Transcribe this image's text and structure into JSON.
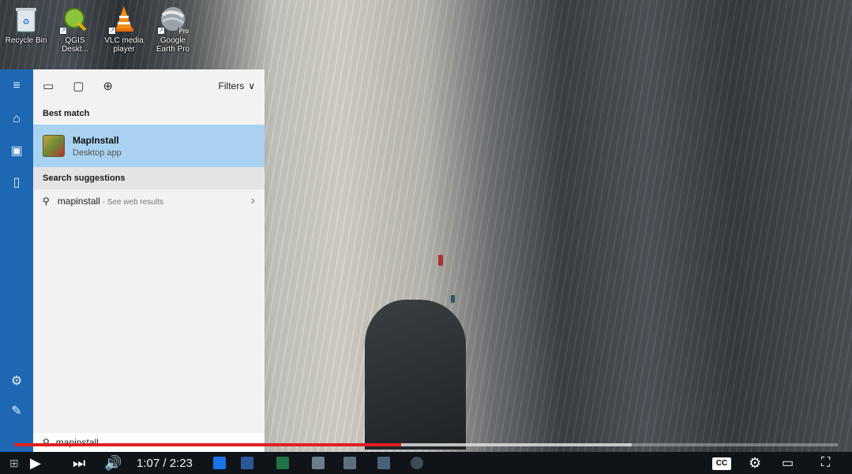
{
  "desktop": {
    "icons": [
      {
        "label": "Recycle Bin",
        "icon": "recycle-bin-icon"
      },
      {
        "label": "QGIS Deskt...",
        "icon": "qgis-icon"
      },
      {
        "label": "VLC media player",
        "icon": "vlc-icon"
      },
      {
        "label": "Google Earth Pro",
        "icon": "google-earth-icon"
      }
    ],
    "earth_badge": "Pro"
  },
  "start_menu": {
    "rail_icons": [
      "hamburger-menu-icon",
      "home-icon",
      "notebook-icon",
      "device-icon",
      "settings-icon",
      "feedback-icon"
    ],
    "toolbar": {
      "filters_label": "Filters"
    },
    "best_match": {
      "heading": "Best match",
      "app_name": "MapInstall",
      "app_type": "Desktop app"
    },
    "suggestions": {
      "heading": "Search suggestions",
      "query": "mapinstall",
      "hint": " - See web results"
    },
    "search_box": {
      "value": "mapinstall"
    }
  },
  "player": {
    "current_time": "1:07",
    "duration": "2:23",
    "time_display": "1:07 / 2:23",
    "progress_fraction": 0.47,
    "buffer_fraction": 0.75,
    "cc_label": "CC",
    "accent": "#e02020"
  }
}
